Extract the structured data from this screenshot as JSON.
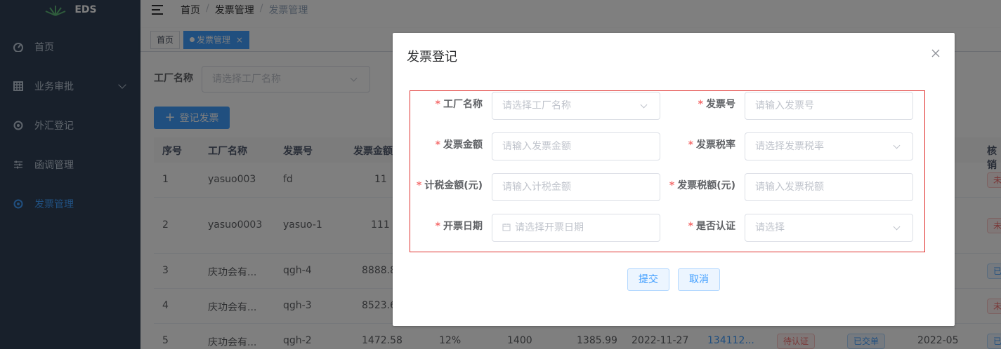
{
  "app": {
    "logo_text": "EDS"
  },
  "sidebar": {
    "items": [
      {
        "label": "首页",
        "icon": "dashboard-icon"
      },
      {
        "label": "业务审批",
        "icon": "grid-icon",
        "has_children": true
      },
      {
        "label": "外汇登记",
        "icon": "compass-icon"
      },
      {
        "label": "函调管理",
        "icon": "sliders-icon"
      },
      {
        "label": "发票管理",
        "icon": "compass-icon",
        "active": true
      }
    ]
  },
  "header": {
    "breadcrumb": [
      "首页",
      "发票管理",
      "发票管理"
    ]
  },
  "tags": [
    {
      "label": "首页",
      "active": false
    },
    {
      "label": "发票管理",
      "active": true
    }
  ],
  "filter": {
    "label": "工厂名称",
    "placeholder": "请选择工厂名称"
  },
  "toolbar": {
    "add_label": "登记发票"
  },
  "table": {
    "headers": [
      "序号",
      "工厂名称",
      "发票号",
      "发票金额(",
      "核销"
    ],
    "rows": [
      {
        "index": "1",
        "factory": "yasuo003",
        "invoice_no": "fd",
        "amount": "11",
        "status_tag": "未"
      },
      {
        "index": "2",
        "factory": "yasuo0003",
        "invoice_no": "yasuo-1",
        "amount": "111",
        "status_tag": "未"
      },
      {
        "index": "3",
        "factory": "庆功会有...",
        "invoice_no": "qgh-4",
        "amount": "8888.8",
        "status_tag": "已"
      },
      {
        "index": "4",
        "factory": "庆功会有...",
        "invoice_no": "qgh-3",
        "amount": "8523.6",
        "status_tag": "未"
      },
      {
        "index": "5",
        "factory": "庆功会有...",
        "invoice_no": "qgh-2",
        "amount": "1472.58",
        "tax_rate": "12%",
        "taxable": "1400",
        "tax": "1385.99",
        "date": "2022-11-27",
        "link": "134112...",
        "auth": "待认证",
        "submit": "已交单",
        "month": "2022-05",
        "status_tag": "已"
      }
    ]
  },
  "dialog": {
    "title": "发票登记",
    "fields": [
      {
        "label": "工厂名称",
        "placeholder": "请选择工厂名称",
        "type": "select"
      },
      {
        "label": "发票号",
        "placeholder": "请输入发票号",
        "type": "input"
      },
      {
        "label": "发票金额",
        "placeholder": "请输入发票金额",
        "type": "input"
      },
      {
        "label": "发票税率",
        "placeholder": "请选择发票税率",
        "type": "select"
      },
      {
        "label": "计税金额(元)",
        "placeholder": "请输入计税金额",
        "type": "input"
      },
      {
        "label": "发票税额(元)",
        "placeholder": "请输入发票税额",
        "type": "input"
      },
      {
        "label": "开票日期",
        "placeholder": "请选择开票日期",
        "type": "date"
      },
      {
        "label": "是否认证",
        "placeholder": "请选择",
        "type": "select"
      }
    ],
    "submit_label": "提交",
    "cancel_label": "取消"
  },
  "colors": {
    "sidebar_bg": "#304156",
    "primary": "#409eff",
    "danger": "#f56c6c",
    "form_border": "#e0312e"
  }
}
